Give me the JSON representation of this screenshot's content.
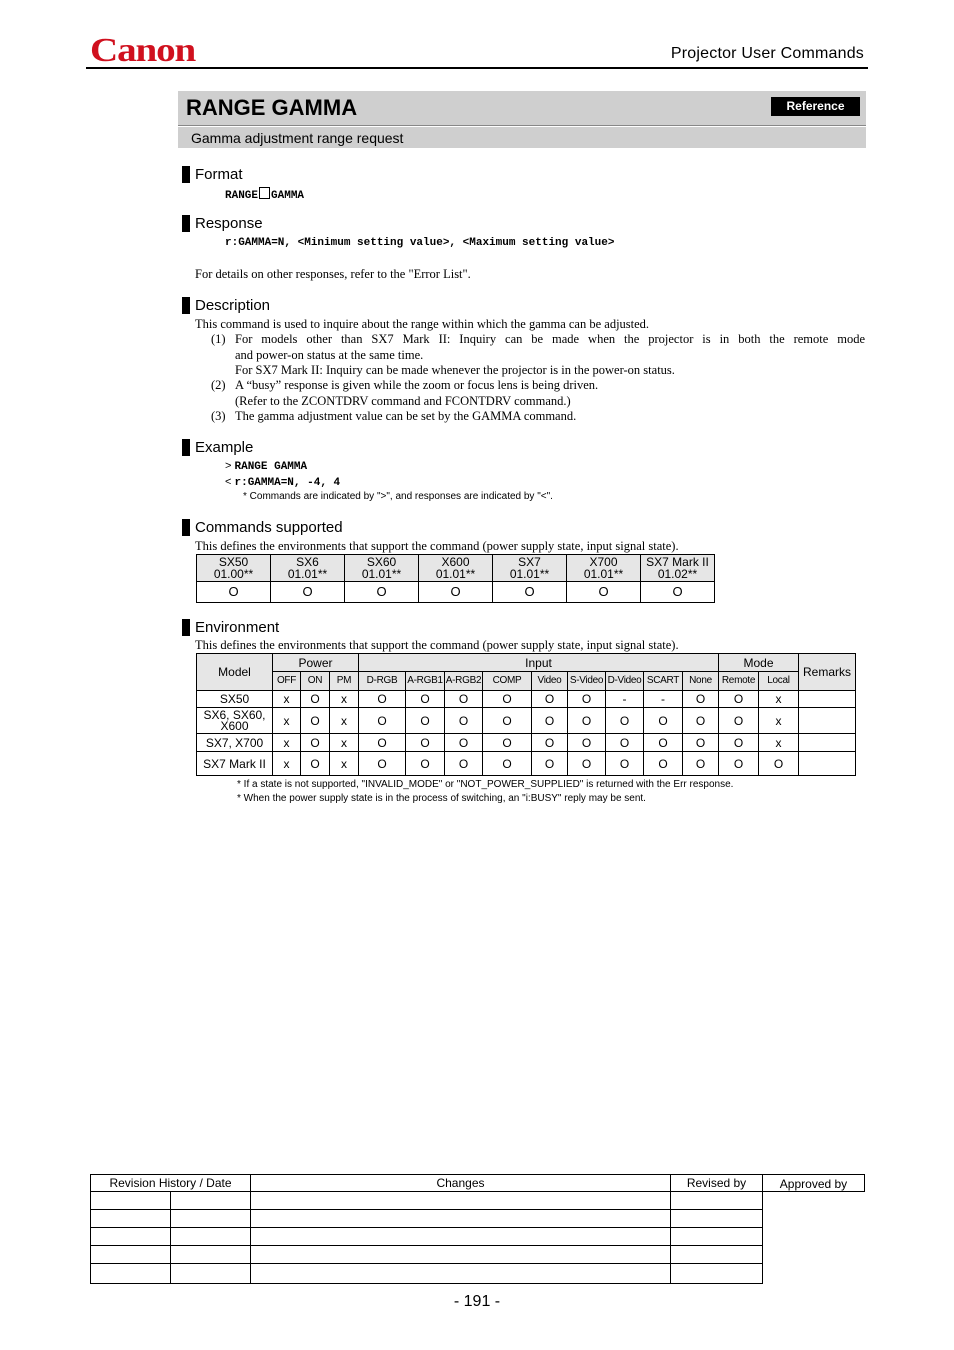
{
  "header": {
    "brand": "Canon",
    "brand_color": "#d0101e",
    "doc_title": "Projector User Commands"
  },
  "command": {
    "title": "RANGE GAMMA",
    "badge": "Reference",
    "subtitle": "Gamma adjustment range request"
  },
  "format": {
    "heading": "Format",
    "code_part1": "RANGE",
    "code_part2": "GAMMA"
  },
  "response": {
    "heading": "Response",
    "code": "r:GAMMA=N, <Minimum setting value>, <Maximum setting value>",
    "note": "For details on other responses, refer to the \"Error List\"."
  },
  "description": {
    "heading": "Description",
    "intro": "This command is used to inquire about the range within which the gamma can be adjusted.",
    "items": [
      {
        "num": "(1)",
        "lines": [
          "For models other than SX7 Mark II: Inquiry can be made when the projector is in both the remote mode",
          "and power-on status at the same time.",
          "For SX7 Mark II: Inquiry can be made whenever the projector is in the power-on status."
        ]
      },
      {
        "num": "(2)",
        "lines": [
          "A “busy” response is given while the zoom or focus lens is being driven.",
          "(Refer to the ZCONTDRV command and FCONTDRV command.)"
        ]
      },
      {
        "num": "(3)",
        "lines": [
          "The gamma adjustment value can be set by the GAMMA command."
        ]
      }
    ]
  },
  "example": {
    "heading": "Example",
    "cmd_prefix": ">",
    "cmd": "RANGE GAMMA",
    "resp_prefix": "<",
    "resp": "r:GAMMA=N, -4, 4",
    "note": "* Commands are indicated by \">\", and responses are indicated by \"<\"."
  },
  "commands_supported": {
    "heading": "Commands supported",
    "intro": "This defines the environments that support the command (power supply state, input signal state).",
    "models": [
      {
        "name": "SX50",
        "version": "01.00**",
        "value": "O"
      },
      {
        "name": "SX6",
        "version": "01.01**",
        "value": "O"
      },
      {
        "name": "SX60",
        "version": "01.01**",
        "value": "O"
      },
      {
        "name": "X600",
        "version": "01.01**",
        "value": "O"
      },
      {
        "name": "SX7",
        "version": "01.01**",
        "value": "O"
      },
      {
        "name": "X700",
        "version": "01.01**",
        "value": "O"
      },
      {
        "name": "SX7 Mark II",
        "version": "01.02**",
        "value": "O"
      }
    ]
  },
  "environment": {
    "heading": "Environment",
    "intro": "This defines the environments that support the command (power supply state, input signal state).",
    "group_headers": {
      "model": "Model",
      "power": "Power",
      "input": "Input",
      "mode": "Mode",
      "remarks": "Remarks"
    },
    "columns": [
      "OFF",
      "ON",
      "PM",
      "D-RGB",
      "A-RGB1",
      "A-RGB2",
      "COMP",
      "Video",
      "S-Video",
      "D-Video",
      "SCART",
      "None",
      "Remote",
      "Local"
    ],
    "rows": [
      {
        "model": "SX50",
        "values": [
          "x",
          "O",
          "x",
          "O",
          "O",
          "O",
          "O",
          "O",
          "O",
          "-",
          "-",
          "O",
          "O",
          "x"
        ],
        "remarks": ""
      },
      {
        "model": "SX6, SX60, X600",
        "values": [
          "x",
          "O",
          "x",
          "O",
          "O",
          "O",
          "O",
          "O",
          "O",
          "O",
          "O",
          "O",
          "O",
          "x"
        ],
        "remarks": ""
      },
      {
        "model": "SX7, X700",
        "values": [
          "x",
          "O",
          "x",
          "O",
          "O",
          "O",
          "O",
          "O",
          "O",
          "O",
          "O",
          "O",
          "O",
          "x"
        ],
        "remarks": ""
      },
      {
        "model": "SX7 Mark II",
        "values": [
          "x",
          "O",
          "x",
          "O",
          "O",
          "O",
          "O",
          "O",
          "O",
          "O",
          "O",
          "O",
          "O",
          "O"
        ],
        "remarks": ""
      }
    ],
    "notes": [
      "*  If a state is not supported, \"INVALID_MODE\" or \"NOT_POWER_SUPPLIED\" is returned with the Err response.",
      "*  When the power supply state is in the process of switching, an \"i:BUSY\" reply may be sent."
    ]
  },
  "revision": {
    "headers": {
      "history": "Revision History / Date",
      "changes": "Changes",
      "revised_by": "Revised by",
      "approved_by": "Approved by"
    },
    "row_count": 5
  },
  "page_number": "- 191 -"
}
